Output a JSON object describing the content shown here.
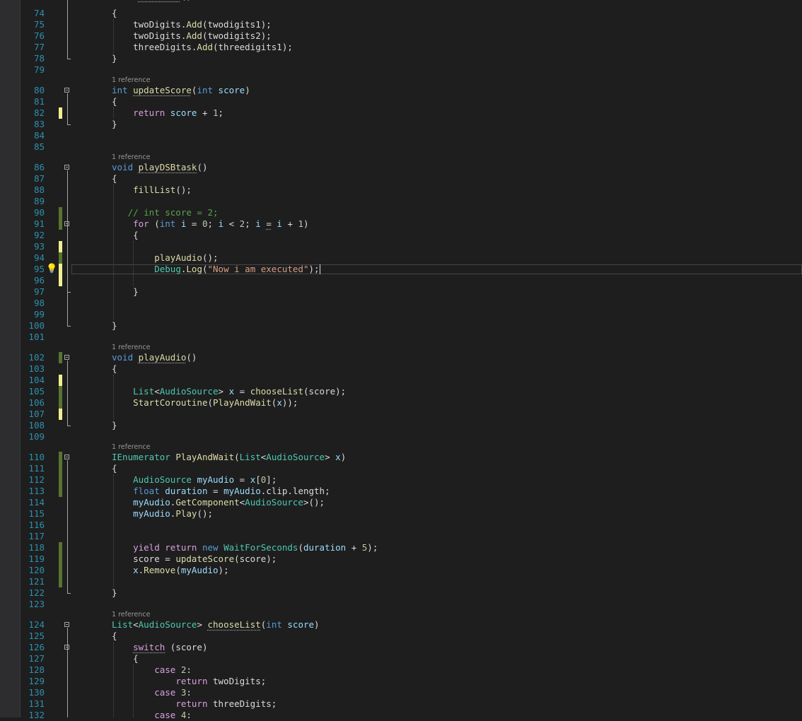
{
  "editor": {
    "lines": [
      {
        "n": "74",
        "segs": [
          {
            "t": "{"
          }
        ]
      },
      {
        "n": "75",
        "segs": [
          {
            "t": "    twoDigits."
          },
          {
            "t": "Add",
            "c": "fn"
          },
          {
            "t": "(twodigits1);"
          }
        ]
      },
      {
        "n": "76",
        "segs": [
          {
            "t": "    twoDigits."
          },
          {
            "t": "Add",
            "c": "fn"
          },
          {
            "t": "(twodigits2);"
          }
        ]
      },
      {
        "n": "77",
        "segs": [
          {
            "t": "    threeDigits."
          },
          {
            "t": "Add",
            "c": "fn"
          },
          {
            "t": "(threedigits1);"
          }
        ]
      },
      {
        "n": "78",
        "segs": [
          {
            "t": "}"
          }
        ]
      },
      {
        "n": "79",
        "segs": []
      },
      {
        "n": "80",
        "lens": "1 reference",
        "fold": true,
        "segs": [
          {
            "t": "int",
            "c": "kw"
          },
          {
            "t": " "
          },
          {
            "t": "updateScore",
            "c": "fn sq"
          },
          {
            "t": "("
          },
          {
            "t": "int",
            "c": "kw"
          },
          {
            "t": " "
          },
          {
            "t": "score",
            "c": "vr"
          },
          {
            "t": ")"
          }
        ]
      },
      {
        "n": "81",
        "segs": [
          {
            "t": "{"
          }
        ]
      },
      {
        "n": "82",
        "chg": "unsaved",
        "segs": [
          {
            "t": "    "
          },
          {
            "t": "return",
            "c": "ctl"
          },
          {
            "t": " "
          },
          {
            "t": "score",
            "c": "vr"
          },
          {
            "t": " + "
          },
          {
            "t": "1",
            "c": "nm"
          },
          {
            "t": ";"
          }
        ]
      },
      {
        "n": "83",
        "segs": [
          {
            "t": "}"
          }
        ]
      },
      {
        "n": "84",
        "segs": []
      },
      {
        "n": "85",
        "segs": []
      },
      {
        "n": "86",
        "lens": "1 reference",
        "fold": true,
        "segs": [
          {
            "t": "void",
            "c": "kw"
          },
          {
            "t": " "
          },
          {
            "t": "playDSBtask",
            "c": "fn sq"
          },
          {
            "t": "()"
          }
        ]
      },
      {
        "n": "87",
        "segs": [
          {
            "t": "{"
          }
        ]
      },
      {
        "n": "88",
        "segs": [
          {
            "t": "    "
          },
          {
            "t": "fillList",
            "c": "fn"
          },
          {
            "t": "();"
          }
        ]
      },
      {
        "n": "89",
        "segs": []
      },
      {
        "n": "90",
        "chg": "saved",
        "segs": [
          {
            "t": "   "
          },
          {
            "t": "// int score = 2;",
            "c": "cm"
          }
        ]
      },
      {
        "n": "91",
        "chg": "saved",
        "fold": true,
        "segs": [
          {
            "t": "    "
          },
          {
            "t": "for",
            "c": "ctl"
          },
          {
            "t": " ("
          },
          {
            "t": "int",
            "c": "kw"
          },
          {
            "t": " "
          },
          {
            "t": "i",
            "c": "vr"
          },
          {
            "t": " = "
          },
          {
            "t": "0",
            "c": "nm"
          },
          {
            "t": "; "
          },
          {
            "t": "i",
            "c": "vr"
          },
          {
            "t": " < "
          },
          {
            "t": "2",
            "c": "nm"
          },
          {
            "t": "; "
          },
          {
            "t": "i",
            "c": "vr"
          },
          {
            "t": " "
          },
          {
            "t": "=",
            "c": "sq"
          },
          {
            "t": " "
          },
          {
            "t": "i",
            "c": "vr"
          },
          {
            "t": " + "
          },
          {
            "t": "1",
            "c": "nm"
          },
          {
            "t": ")"
          }
        ]
      },
      {
        "n": "92",
        "segs": [
          {
            "t": "    {"
          }
        ]
      },
      {
        "n": "93",
        "chg": "unsaved",
        "segs": []
      },
      {
        "n": "94",
        "chg": "saved",
        "segs": [
          {
            "t": "        "
          },
          {
            "t": "playAudio",
            "c": "fn"
          },
          {
            "t": "();"
          }
        ]
      },
      {
        "n": "95",
        "chg": "unsaved",
        "bulb": true,
        "current": true,
        "segs": [
          {
            "t": "        "
          },
          {
            "t": "Debug",
            "c": "ty"
          },
          {
            "t": "."
          },
          {
            "t": "Log",
            "c": "fn"
          },
          {
            "t": "("
          },
          {
            "t": "\"Now i am executed\"",
            "c": "st"
          },
          {
            "t": ");"
          }
        ]
      },
      {
        "n": "96",
        "chg": "unsaved",
        "segs": []
      },
      {
        "n": "97",
        "segs": [
          {
            "t": "    }"
          }
        ]
      },
      {
        "n": "98",
        "segs": []
      },
      {
        "n": "99",
        "segs": []
      },
      {
        "n": "100",
        "segs": [
          {
            "t": "}"
          }
        ]
      },
      {
        "n": "101",
        "segs": []
      },
      {
        "n": "102",
        "lens": "1 reference",
        "chg": "saved",
        "fold": true,
        "segs": [
          {
            "t": "void",
            "c": "kw"
          },
          {
            "t": " "
          },
          {
            "t": "playAudio",
            "c": "fn sq"
          },
          {
            "t": "()"
          }
        ]
      },
      {
        "n": "103",
        "segs": [
          {
            "t": "{"
          }
        ]
      },
      {
        "n": "104",
        "chg": "unsaved",
        "segs": []
      },
      {
        "n": "105",
        "chg": "saved",
        "segs": [
          {
            "t": "    "
          },
          {
            "t": "List",
            "c": "ty"
          },
          {
            "t": "<"
          },
          {
            "t": "AudioSource",
            "c": "ty"
          },
          {
            "t": "> "
          },
          {
            "t": "x",
            "c": "vr"
          },
          {
            "t": " = "
          },
          {
            "t": "chooseList",
            "c": "fn"
          },
          {
            "t": "(score);"
          }
        ]
      },
      {
        "n": "106",
        "chg": "saved",
        "segs": [
          {
            "t": "    "
          },
          {
            "t": "StartCoroutine",
            "c": "fn"
          },
          {
            "t": "("
          },
          {
            "t": "PlayAndWait",
            "c": "fn"
          },
          {
            "t": "("
          },
          {
            "t": "x",
            "c": "vr"
          },
          {
            "t": "));"
          }
        ]
      },
      {
        "n": "107",
        "chg": "unsaved",
        "segs": []
      },
      {
        "n": "108",
        "segs": [
          {
            "t": "}"
          }
        ]
      },
      {
        "n": "109",
        "segs": []
      },
      {
        "n": "110",
        "lens": "1 reference",
        "chg": "saved",
        "fold": true,
        "segs": [
          {
            "t": "IEnumerator",
            "c": "ty"
          },
          {
            "t": " "
          },
          {
            "t": "PlayAndWait",
            "c": "fn"
          },
          {
            "t": "("
          },
          {
            "t": "List",
            "c": "ty"
          },
          {
            "t": "<"
          },
          {
            "t": "AudioSource",
            "c": "ty"
          },
          {
            "t": "> "
          },
          {
            "t": "x",
            "c": "vr"
          },
          {
            "t": ")"
          }
        ]
      },
      {
        "n": "111",
        "chg": "saved",
        "segs": [
          {
            "t": "{"
          }
        ]
      },
      {
        "n": "112",
        "chg": "saved",
        "segs": [
          {
            "t": "    "
          },
          {
            "t": "AudioSource",
            "c": "ty"
          },
          {
            "t": " "
          },
          {
            "t": "myAudio",
            "c": "vr"
          },
          {
            "t": " = "
          },
          {
            "t": "x",
            "c": "vr"
          },
          {
            "t": "["
          },
          {
            "t": "0",
            "c": "nm"
          },
          {
            "t": "];"
          }
        ]
      },
      {
        "n": "113",
        "chg": "saved",
        "segs": [
          {
            "t": "    "
          },
          {
            "t": "float",
            "c": "kw"
          },
          {
            "t": " "
          },
          {
            "t": "duration",
            "c": "vr"
          },
          {
            "t": " = "
          },
          {
            "t": "myAudio",
            "c": "vr"
          },
          {
            "t": ".clip.length;"
          }
        ]
      },
      {
        "n": "114",
        "segs": [
          {
            "t": "    "
          },
          {
            "t": "myAudio",
            "c": "vr"
          },
          {
            "t": "."
          },
          {
            "t": "GetComponent",
            "c": "fn"
          },
          {
            "t": "<"
          },
          {
            "t": "AudioSource",
            "c": "ty"
          },
          {
            "t": ">();"
          }
        ]
      },
      {
        "n": "115",
        "segs": [
          {
            "t": "    "
          },
          {
            "t": "myAudio",
            "c": "vr"
          },
          {
            "t": "."
          },
          {
            "t": "Play",
            "c": "fn"
          },
          {
            "t": "();"
          }
        ]
      },
      {
        "n": "116",
        "segs": []
      },
      {
        "n": "117",
        "segs": []
      },
      {
        "n": "118",
        "chg": "saved",
        "segs": [
          {
            "t": "    "
          },
          {
            "t": "yield",
            "c": "ctl"
          },
          {
            "t": " "
          },
          {
            "t": "return",
            "c": "ctl"
          },
          {
            "t": " "
          },
          {
            "t": "new",
            "c": "kw"
          },
          {
            "t": " "
          },
          {
            "t": "WaitForSeconds",
            "c": "ty"
          },
          {
            "t": "("
          },
          {
            "t": "duration",
            "c": "vr"
          },
          {
            "t": " + "
          },
          {
            "t": "5",
            "c": "nm"
          },
          {
            "t": ");"
          }
        ]
      },
      {
        "n": "119",
        "chg": "saved",
        "segs": [
          {
            "t": "    score = "
          },
          {
            "t": "updateScore",
            "c": "fn"
          },
          {
            "t": "(score);"
          }
        ]
      },
      {
        "n": "120",
        "chg": "saved",
        "segs": [
          {
            "t": "    "
          },
          {
            "t": "x",
            "c": "vr"
          },
          {
            "t": "."
          },
          {
            "t": "Remove",
            "c": "fn"
          },
          {
            "t": "("
          },
          {
            "t": "myAudio",
            "c": "vr"
          },
          {
            "t": ");"
          }
        ]
      },
      {
        "n": "121",
        "chg": "saved",
        "segs": []
      },
      {
        "n": "122",
        "segs": [
          {
            "t": "}"
          }
        ]
      },
      {
        "n": "123",
        "segs": []
      },
      {
        "n": "124",
        "lens": "1 reference",
        "fold": true,
        "segs": [
          {
            "t": "List",
            "c": "ty"
          },
          {
            "t": "<"
          },
          {
            "t": "AudioSource",
            "c": "ty"
          },
          {
            "t": "> "
          },
          {
            "t": "chooseList",
            "c": "fn sq"
          },
          {
            "t": "("
          },
          {
            "t": "int",
            "c": "kw"
          },
          {
            "t": " "
          },
          {
            "t": "score",
            "c": "vr"
          },
          {
            "t": ")"
          }
        ]
      },
      {
        "n": "125",
        "segs": [
          {
            "t": "{"
          }
        ]
      },
      {
        "n": "126",
        "fold": true,
        "segs": [
          {
            "t": "    "
          },
          {
            "t": "switch",
            "c": "ctl sq"
          },
          {
            "t": " (score)"
          }
        ]
      },
      {
        "n": "127",
        "segs": [
          {
            "t": "    {"
          }
        ]
      },
      {
        "n": "128",
        "segs": [
          {
            "t": "        "
          },
          {
            "t": "case",
            "c": "ctl"
          },
          {
            "t": " "
          },
          {
            "t": "2",
            "c": "nm"
          },
          {
            "t": ":"
          }
        ]
      },
      {
        "n": "129",
        "segs": [
          {
            "t": "            "
          },
          {
            "t": "return",
            "c": "ctl"
          },
          {
            "t": " twoDigits;"
          }
        ]
      },
      {
        "n": "130",
        "segs": [
          {
            "t": "        "
          },
          {
            "t": "case",
            "c": "ctl"
          },
          {
            "t": " "
          },
          {
            "t": "3",
            "c": "nm"
          },
          {
            "t": ":"
          }
        ]
      },
      {
        "n": "131",
        "segs": [
          {
            "t": "            "
          },
          {
            "t": "return",
            "c": "ctl"
          },
          {
            "t": " threeDigits;"
          }
        ]
      },
      {
        "n": "132",
        "segs": [
          {
            "t": "        "
          },
          {
            "t": "case",
            "c": "ctl"
          },
          {
            "t": " "
          },
          {
            "t": "4",
            "c": "nm"
          },
          {
            "t": ":"
          }
        ]
      }
    ]
  },
  "colors": {
    "background": "#1e1e1e",
    "line_number": "#2b91af",
    "change_saved": "#577430",
    "change_unsaved": "#efef91"
  }
}
